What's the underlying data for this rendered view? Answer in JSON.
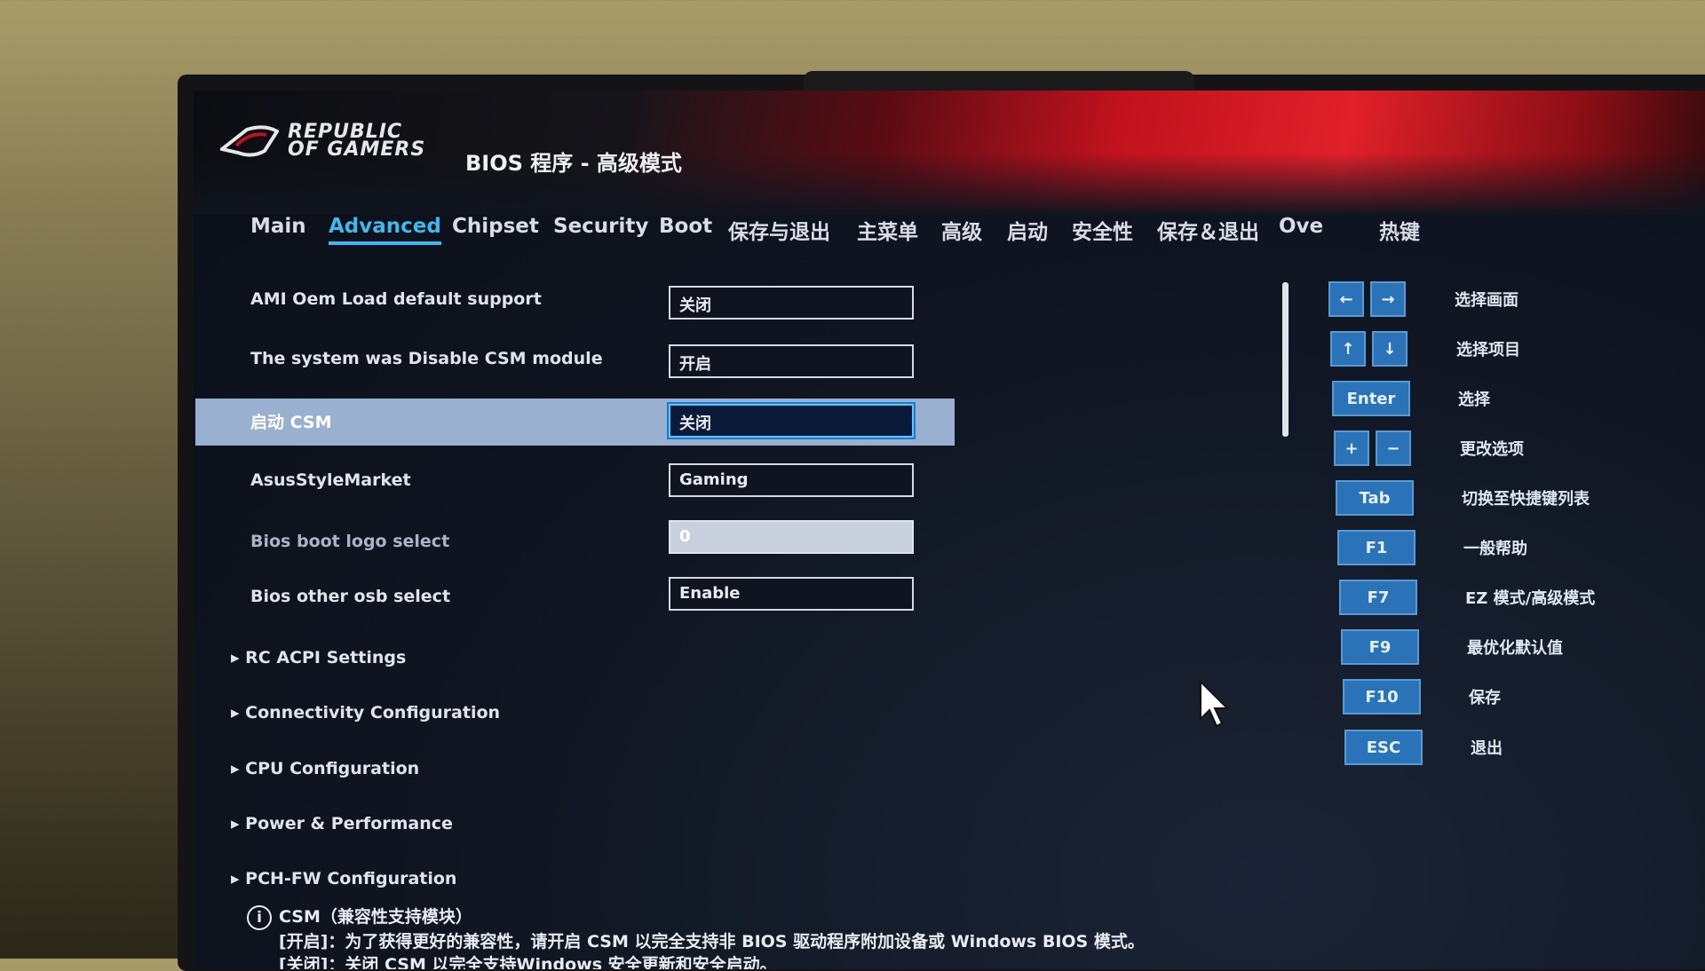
{
  "header": {
    "brand": "REPUBLIC OF GAMERS",
    "title": "BIOS 程序 - 高级模式"
  },
  "tabs": [
    {
      "label": "Main"
    },
    {
      "label": "Advanced",
      "active": true
    },
    {
      "label": "Chipset"
    },
    {
      "label": "Security"
    },
    {
      "label": "Boot"
    },
    {
      "label": "保存与退出"
    },
    {
      "label": "主菜单"
    },
    {
      "label": "高级"
    },
    {
      "label": "启动"
    },
    {
      "label": "安全性"
    },
    {
      "label": "保存＆退出"
    },
    {
      "label": "Ove"
    },
    {
      "label": "热键"
    }
  ],
  "settings": [
    {
      "label": "AMI Oem Load default support",
      "value": "关闭"
    },
    {
      "label": "The system was Disable CSM module",
      "value": "开启"
    },
    {
      "label": "启动 CSM",
      "value": "关闭",
      "selected": true
    },
    {
      "label": "AsusStyleMarket",
      "value": "Gaming"
    },
    {
      "label": "Bios boot logo select",
      "value": "0",
      "disabled": true
    },
    {
      "label": "Bios other osb select",
      "value": "Enable"
    }
  ],
  "submenus": [
    "RC ACPI Settings",
    "Connectivity Configuration",
    "CPU Configuration",
    "Power & Performance",
    "PCH-FW Configuration"
  ],
  "hotkeys": [
    {
      "keys": [
        "←",
        "→"
      ],
      "desc": "选择画面"
    },
    {
      "keys": [
        "↑",
        "↓"
      ],
      "desc": "选择项目"
    },
    {
      "keys": [
        "Enter"
      ],
      "desc": "选择"
    },
    {
      "keys": [
        "+",
        "−"
      ],
      "desc": "更改选项"
    },
    {
      "keys": [
        "Tab"
      ],
      "desc": "切换至快捷键列表"
    },
    {
      "keys": [
        "F1"
      ],
      "desc": "一般帮助"
    },
    {
      "keys": [
        "F7"
      ],
      "desc": "EZ 模式/高级模式"
    },
    {
      "keys": [
        "F9"
      ],
      "desc": "最优化默认值"
    },
    {
      "keys": [
        "F10"
      ],
      "desc": "保存"
    },
    {
      "keys": [
        "ESC"
      ],
      "desc": "退出"
    }
  ],
  "info": {
    "icon": "info-icon",
    "title": "CSM（兼容性支持模块）",
    "line1": "[开启]：为了获得更好的兼容性，请开启 CSM 以完全支持非 BIOS 驱动程序附加设备或 Windows BIOS 模式。",
    "line2": "[关闭]：关闭 CSM 以完全支持Windows 安全更新和安全启动。"
  },
  "colors": {
    "accent": "#3fb8ee",
    "key_bg": "#2b73b8",
    "highlight": "#9ab0d0",
    "header_red": "#e0202a"
  }
}
